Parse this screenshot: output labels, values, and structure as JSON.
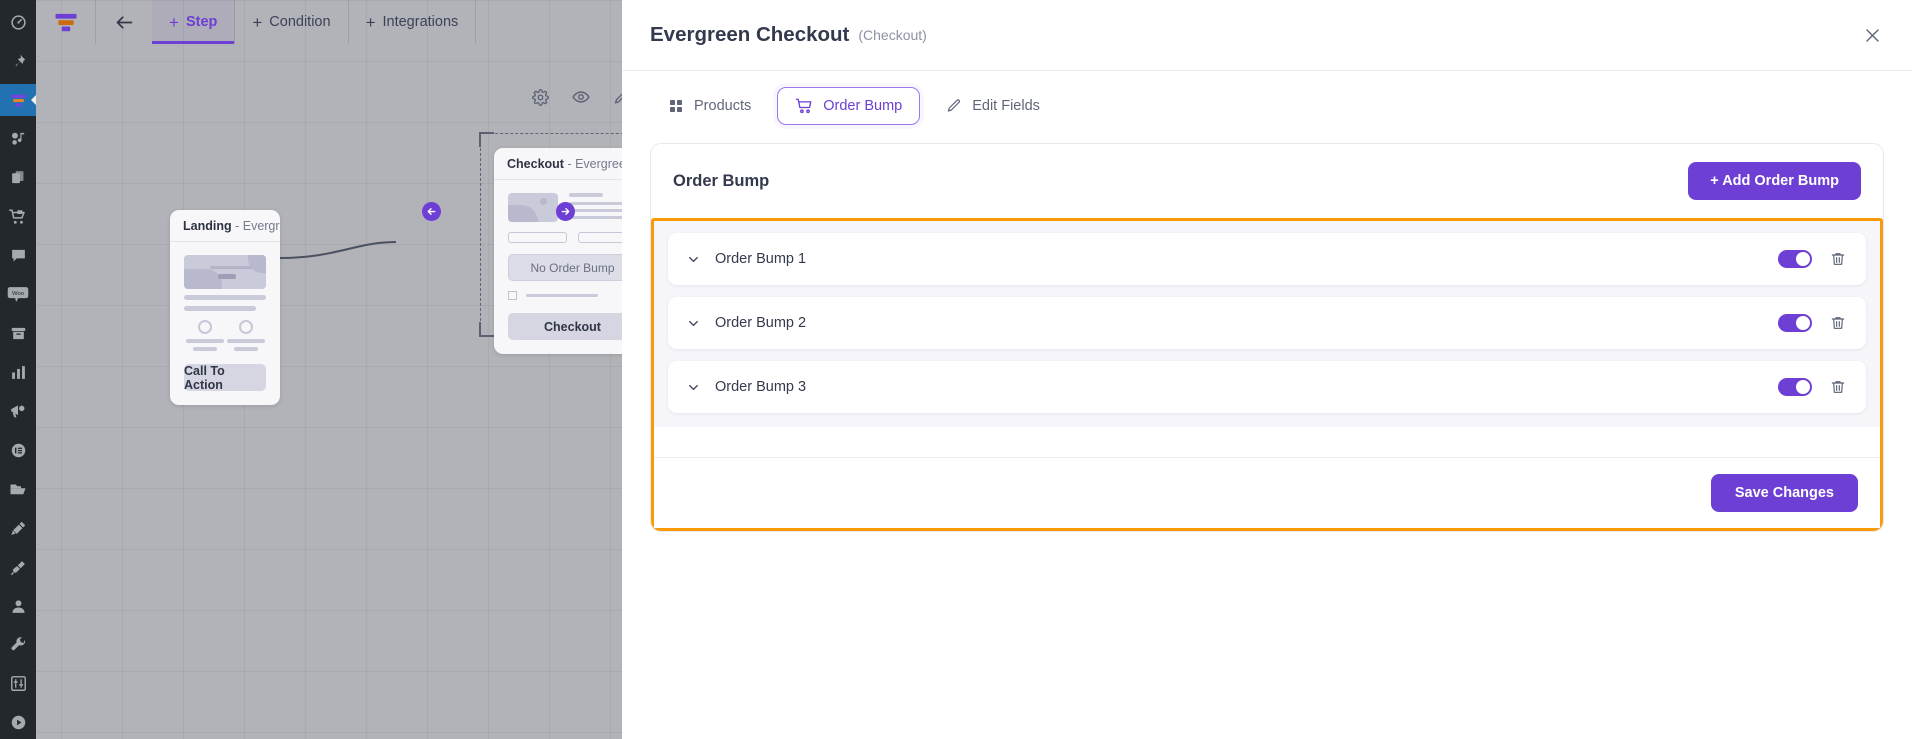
{
  "theme": {
    "accent": "#6d3fd4",
    "highlight_border": "#FB9A07",
    "rail_bg": "#23282d",
    "rail_active_bg": "#2271b1",
    "canvas_bg": "#f4f4f6",
    "panel_bg": "#ffffff",
    "text_dark": "#343a4d",
    "text_muted": "#8b91a3"
  },
  "rail": {
    "items": [
      {
        "icon": "dashboard-gauge-icon",
        "active": false
      },
      {
        "icon": "pin-icon",
        "active": false
      },
      {
        "icon": "funnel-icon",
        "active": true
      },
      {
        "icon": "media-music-icon",
        "active": false
      },
      {
        "icon": "copy-pages-icon",
        "active": false
      },
      {
        "icon": "shopping-cart-icon",
        "active": false
      },
      {
        "icon": "comment-icon",
        "active": false
      },
      {
        "icon": "woo-icon",
        "label": "Woo",
        "active": false
      },
      {
        "icon": "archive-box-icon",
        "active": false
      },
      {
        "icon": "bar-chart-icon",
        "active": false
      },
      {
        "icon": "megaphone-icon",
        "active": false
      },
      {
        "icon": "list-circle-icon",
        "active": false
      },
      {
        "icon": "folder-icon",
        "active": false
      },
      {
        "icon": "paintbrush-icon",
        "active": false
      },
      {
        "icon": "plug-icon",
        "active": false
      },
      {
        "icon": "user-icon",
        "active": false
      },
      {
        "icon": "wrench-icon",
        "active": false
      },
      {
        "icon": "sliders-icon",
        "active": false
      },
      {
        "icon": "play-circle-icon",
        "active": false
      }
    ]
  },
  "toolbar": {
    "logo_icon": "funnel-logo-icon",
    "back_icon": "arrow-left-icon",
    "buttons": [
      {
        "label": "Step",
        "icon": "plus-icon",
        "active": true
      },
      {
        "label": "Condition",
        "icon": "plus-icon",
        "active": false
      },
      {
        "label": "Integrations",
        "icon": "plus-icon",
        "active": false
      }
    ]
  },
  "canvas": {
    "node_tools": [
      "gear-icon",
      "eye-icon",
      "pencil-icon",
      "vertical-dots-icon"
    ],
    "nodes": [
      {
        "type": "Landing",
        "type_label": "Landing",
        "name_label": "- Evergreen Lan...",
        "cta_label": "Call To Action"
      },
      {
        "type": "Checkout",
        "type_label": "Checkout",
        "name_label": "- Evergreen Che...",
        "ghost_label": "No Order Bump",
        "cta_label": "Checkout",
        "selected": true
      }
    ],
    "connectors": [
      {
        "icon": "arrow-left-circle-icon"
      },
      {
        "icon": "arrow-right-circle-icon"
      }
    ]
  },
  "panel": {
    "title": "Evergreen Checkout",
    "subtitle": "(Checkout)",
    "close_icon": "close-icon",
    "tabs": [
      {
        "label": "Products",
        "icon": "grid-icon",
        "active": false
      },
      {
        "label": "Order Bump",
        "icon": "cart-icon",
        "active": true
      },
      {
        "label": "Edit Fields",
        "icon": "pencil-icon",
        "active": false
      }
    ],
    "card": {
      "title": "Order Bump",
      "add_button_label": "+ Add Order Bump",
      "bumps": [
        {
          "label": "Order Bump 1",
          "enabled": true,
          "chevron_icon": "chevron-down-icon",
          "delete_icon": "trash-icon"
        },
        {
          "label": "Order Bump 2",
          "enabled": true,
          "chevron_icon": "chevron-down-icon",
          "delete_icon": "trash-icon"
        },
        {
          "label": "Order Bump 3",
          "enabled": true,
          "chevron_icon": "chevron-down-icon",
          "delete_icon": "trash-icon"
        }
      ],
      "save_button_label": "Save Changes"
    }
  }
}
